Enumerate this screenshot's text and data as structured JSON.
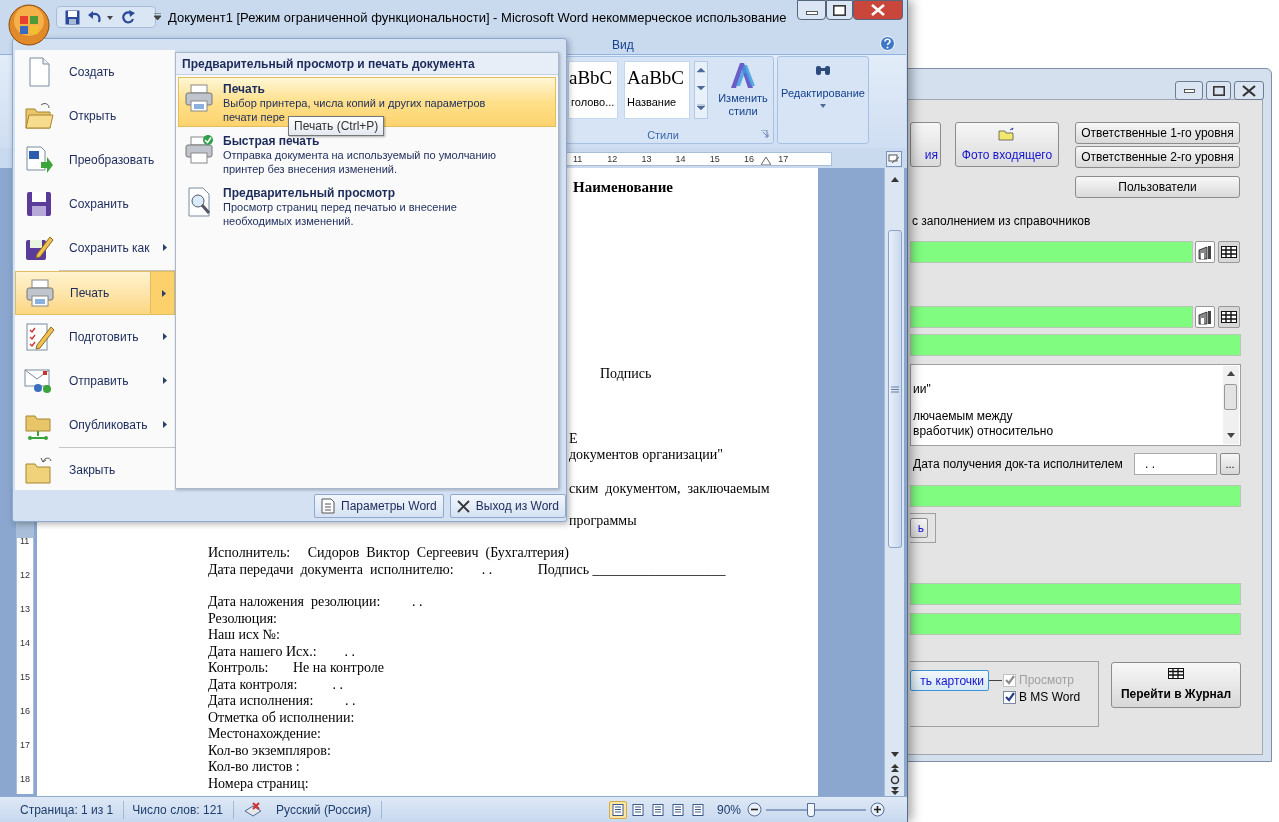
{
  "word_window": {
    "title": "Документ1 [Режим ограниченной функциональности] - Microsoft Word некоммерческое использование",
    "tabs": [
      {
        "label": "Вид",
        "selected": false
      }
    ],
    "styles": [
      {
        "sample": "aBbC",
        "name": "голово..."
      },
      {
        "sample": "AaBbC",
        "name": "Название"
      }
    ],
    "change_styles": "Изменить стили",
    "styles_group": "Стили",
    "editing": "Редактирование",
    "ruler": [
      "11",
      "12",
      "13",
      "14",
      "15",
      "16",
      "17"
    ],
    "vruler": [
      "11",
      "12",
      "13",
      "14",
      "15",
      "16",
      "17",
      "18"
    ],
    "document": {
      "lines": [
        {
          "kind": "heading",
          "text": "Наименование"
        },
        {
          "kind": "line",
          "text": "Подпись"
        },
        {
          "kind": "line",
          "text": "Е"
        },
        {
          "kind": "line",
          "text": "документов организации\""
        },
        {
          "kind": "line",
          "text": "ским  документом,  заключаемым"
        },
        {
          "kind": "line",
          "text": "программы"
        }
      ],
      "paragraphs": [
        {
          "lines": [
            "Исполнитель:     Сидоров  Виктор  Сергеевич  (Бухгалтерия)",
            "Дата передачи  документа  исполнителю:        . .             Подпись ___________________"
          ]
        },
        {
          "lines": [
            "Дата наложения  резолюции:         . .",
            "Резолюция:",
            "Наш исх №:",
            "Дата нашего Исх.:        . .",
            "Контроль:       Не на контроле",
            "Дата контроля:          . .",
            "Дата исполнения:         . .",
            "Отметка об исполнении:",
            "Местонахождение:",
            "Кол-во экземпляров:",
            "Кол-во листов :",
            "Номера страниц:"
          ]
        }
      ]
    },
    "status_bar": {
      "page": "Страница: 1 из 1",
      "words": "Число слов: 121",
      "language": "Русский (Россия)",
      "zoom": "90%",
      "views": [
        {
          "selected": true
        },
        {
          "selected": false
        },
        {
          "selected": false
        },
        {
          "selected": false
        },
        {
          "selected": false
        }
      ],
      "zoom_slider": {
        "level": 0.45
      }
    }
  },
  "office_menu": {
    "items": [
      {
        "kind": "new",
        "label": "Создать",
        "submenu": false,
        "selected": false
      },
      {
        "kind": "open",
        "label": "Открыть",
        "submenu": false,
        "selected": false
      },
      {
        "kind": "convert",
        "label": "Преобразовать",
        "submenu": false,
        "selected": false
      },
      {
        "kind": "save",
        "label": "Сохранить",
        "submenu": false,
        "selected": false
      },
      {
        "kind": "saveas",
        "label": "Сохранить как",
        "submenu": true,
        "selected": false
      },
      {
        "kind": "print",
        "label": "Печать",
        "submenu": true,
        "selected": true
      },
      {
        "kind": "prepare",
        "label": "Подготовить",
        "submenu": true,
        "selected": false
      },
      {
        "kind": "send",
        "label": "Отправить",
        "submenu": true,
        "selected": false
      },
      {
        "kind": "publish",
        "label": "Опубликовать",
        "submenu": true,
        "selected": false
      },
      {
        "kind": "close",
        "label": "Закрыть",
        "submenu": false,
        "selected": false
      }
    ],
    "panel": {
      "heading": "Предварительный просмотр и печать документа",
      "items": [
        {
          "kind": "print",
          "title": "Печать",
          "description": "Выбор принтера, числа копий и других параметров\nпечати пере",
          "selected": true
        },
        {
          "kind": "quickprint",
          "title": "Быстрая печать",
          "description": "Отправка документа на используемый по умолчанию\nпринтер без внесения изменений.",
          "selected": false
        },
        {
          "kind": "preview",
          "title": "Предварительный просмотр",
          "description": "Просмотр страниц перед печатью и внесение\nнеобходимых изменений.",
          "selected": false
        }
      ]
    },
    "tooltip": "Печать (Ctrl+P)",
    "footer_buttons": [
      {
        "kind": "options",
        "label": "Параметры Word"
      },
      {
        "kind": "exit",
        "label": "Выход из Word"
      }
    ]
  },
  "dialog": {
    "top_buttons": [
      {
        "kind": "plain",
        "label": "ия"
      },
      {
        "kind": "photo",
        "label": "Фото входящего"
      }
    ],
    "side_buttons": [
      "Ответственные 1-го уровня",
      "Ответственные 2-го уровня",
      "Пользователи"
    ],
    "hint": "с заполнением из справочников",
    "fields": [
      {
        "kind": "lookup"
      },
      {
        "kind": "lookup"
      },
      {
        "kind": "plain"
      },
      {
        "kind": "plain"
      },
      {
        "kind": "plain"
      },
      {
        "kind": "plain"
      }
    ],
    "memo_lines": [
      "ии\"",
      "лючаемым между",
      "вработчик) относительно"
    ],
    "date_label": "Дата получения док-та исполнителем",
    "date_value": ". .",
    "date_button": "...",
    "small_button": "ь",
    "print_button": "ть карточки",
    "checkboxes": [
      {
        "label": "Просмотр",
        "checked": true,
        "disabled": true
      },
      {
        "label": "В MS Word",
        "checked": true,
        "disabled": false
      }
    ],
    "journal_button": "Перейти в Журнал"
  }
}
